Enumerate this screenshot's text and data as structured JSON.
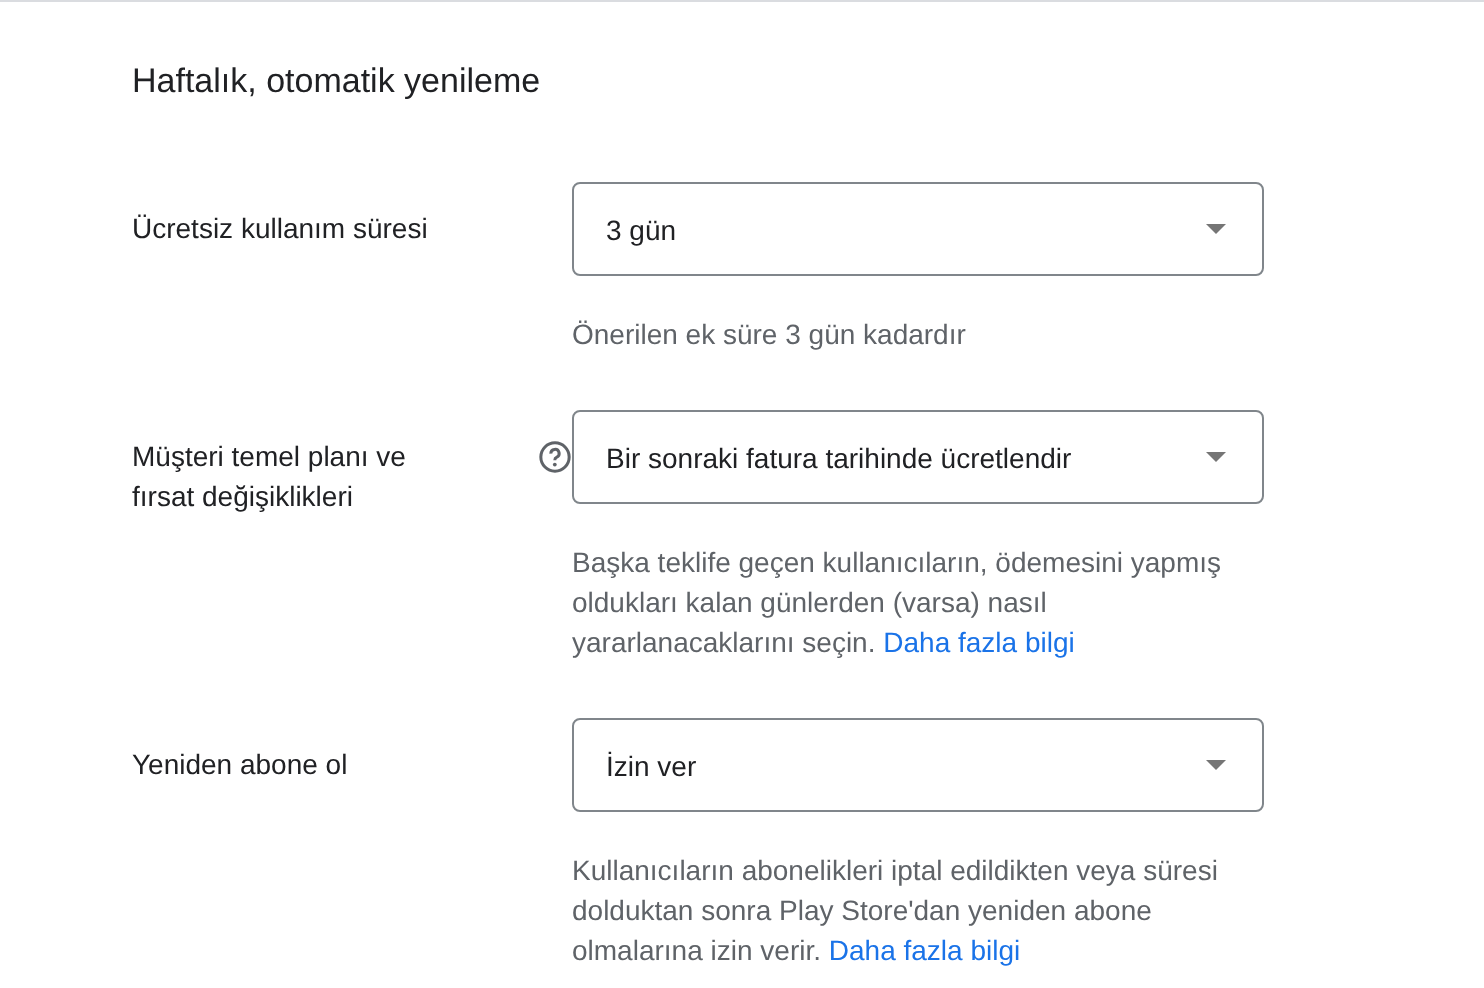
{
  "heading": "Haftalık, otomatik yenileme",
  "fields": [
    {
      "label": "Ücretsiz kullanım süresi",
      "help_icon": false,
      "value": "3 gün",
      "hint": "Önerilen ek süre 3 gün kadardır"
    },
    {
      "label": "Müşteri temel planı ve fırsat değişiklikleri",
      "help_icon": true,
      "value": "Bir sonraki fatura tarihinde ücretlendir",
      "hint": "Başka teklife geçen kullanıcıların, ödemesini yapmış oldukları kalan günlerden (varsa) nasıl yararlanacaklarını seçin.",
      "link": "Daha fazla bilgi"
    },
    {
      "label": "Yeniden abone ol",
      "help_icon": false,
      "value": "İzin ver",
      "hint": "Kullanıcıların abonelikleri iptal edildikten veya süresi dolduktan sonra Play Store'dan yeniden abone olmalarına izin verir.",
      "link": "Daha fazla bilgi"
    }
  ]
}
